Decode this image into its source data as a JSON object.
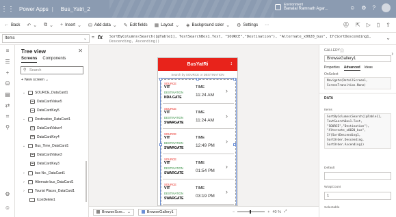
{
  "titlebar": {
    "app_name": "Power Apps",
    "separator": "|",
    "app_title": "Bus_Yatri_2",
    "env_label": "Environment",
    "env_name": "Banalal Ramnath Agar..."
  },
  "commandbar": {
    "back": "Back",
    "insert": "Insert",
    "add_data": "Add data",
    "edit_fields": "Edit fields",
    "layout": "Layout",
    "background_color": "Background color",
    "settings": "Settings",
    "more": "···"
  },
  "formulabar": {
    "property": "Items",
    "formula_line1": "SortByColumns(Search([@Table1], TextSearchBox1.Text, \"SOURCE\",\"Destination\"), \"Alternate_x0020_bus\", If(SortDescending1,",
    "formula_line2": "Descending, Ascending))"
  },
  "treeview": {
    "title": "Tree view",
    "tabs": [
      "Screens",
      "Components"
    ],
    "search_placeholder": "Search",
    "new_screen": "New screen",
    "nodes": [
      {
        "label": "SOURCE_DataCard1",
        "kind": "group",
        "open": true
      },
      {
        "label": "DataCardValue5",
        "kind": "label",
        "open": false
      },
      {
        "label": "DataCardKey5",
        "kind": "label",
        "open": false
      },
      {
        "label": "Destination_DataCard1",
        "kind": "group",
        "open": true
      },
      {
        "label": "DataCardValue4",
        "kind": "label",
        "open": false
      },
      {
        "label": "DataCardKey4",
        "kind": "label",
        "open": false
      },
      {
        "label": "Bus_Time_DataCard1",
        "kind": "group",
        "open": true
      },
      {
        "label": "DataCardValue3",
        "kind": "label",
        "open": false
      },
      {
        "label": "DataCardKey3",
        "kind": "label",
        "open": false
      },
      {
        "label": "bus No._DataCard1",
        "kind": "group",
        "open": false
      },
      {
        "label": "Alternate bus_DataCard1",
        "kind": "group",
        "open": false
      },
      {
        "label": "Tourist Places_DataCard1",
        "kind": "group",
        "open": false
      },
      {
        "label": "IconDelete1",
        "kind": "icon",
        "open": false
      }
    ]
  },
  "phone": {
    "header_title": "BusYatRi",
    "sort_icon": "↕",
    "search_placeholder": "Search by SOURCE or DESTINATION",
    "items": [
      {
        "source_label": "SOURCE",
        "source": "VIT",
        "dest_label": "DESTINATION",
        "destination": "NDA GATE",
        "time_label": "TIME",
        "time": "11:24 AM"
      },
      {
        "source_label": "SOURCE",
        "source": "VIT",
        "dest_label": "DESTINATION",
        "destination": "SWARGATE",
        "time_label": "TIME",
        "time": "11:24 AM"
      },
      {
        "source_label": "SOURCE",
        "source": "VIT",
        "dest_label": "DESTINATION",
        "destination": "SWARGATE",
        "time_label": "TIME",
        "time": "12:49 PM"
      },
      {
        "source_label": "SOURCE",
        "source": "VIT",
        "dest_label": "DESTINATION",
        "destination": "SWARGATE",
        "time_label": "TIME",
        "time": "01:54 PM"
      },
      {
        "source_label": "SOURCE",
        "source": "VIT",
        "dest_label": "DESTINATION",
        "destination": "SWARGATE",
        "time_label": "TIME",
        "time": "03:19 PM"
      }
    ]
  },
  "statusbar": {
    "crumb1": "BrowseScre...",
    "crumb2": "BrowseGallery1",
    "zoom": "40 %"
  },
  "properties": {
    "type": "GALLERY",
    "control_name": "BrowseGallery1",
    "tabs": [
      "Properties",
      "Advanced",
      "Ideas"
    ],
    "active_tab": "Advanced",
    "cut_label": "OnSelect",
    "onselect_code": "Navigate(DetailScreen1,\nScreenTransition.None)",
    "data_section": "DATA",
    "items_label": "Items",
    "items_code": "SortByColumns(Search([@Table1],\nTextSearchBox1.Text,\n\"SOURCE\",\"Destination\"),\n\"Alternate_x0020_bus\",\nIf(SortDescending1,\nSortOrder.Descending,\nSortOrder.Ascending))",
    "default_label": "Default",
    "default_value": "",
    "wrapcount_label": "WrapCount",
    "wrapcount_value": "1",
    "selectable_label": "Selectable"
  }
}
